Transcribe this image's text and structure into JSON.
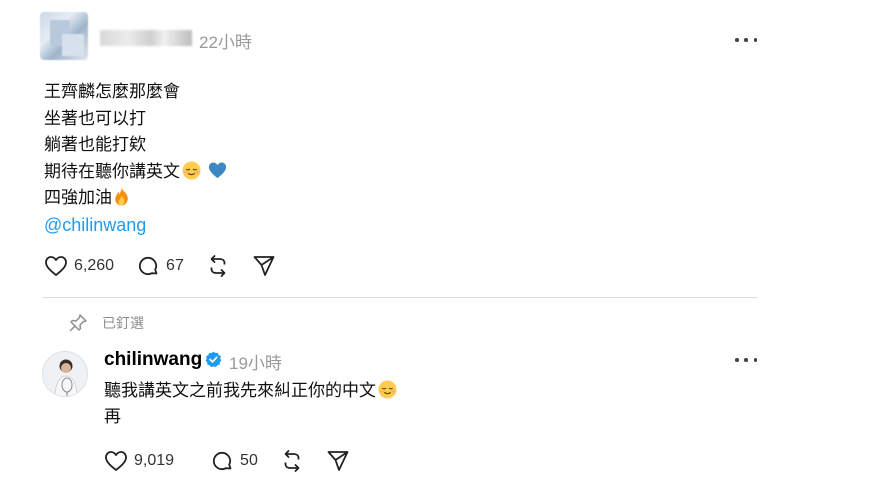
{
  "post": {
    "author_name": "",
    "timestamp": "22小時",
    "lines": [
      "王齊麟怎麼那麼會",
      "坐著也可以打",
      "躺著也能打欸",
      "期待在聽你講英文",
      "四強加油"
    ],
    "emojis": {
      "line4": [
        "relieved-face",
        "blue-heart"
      ],
      "line5": [
        "fire"
      ]
    },
    "mention": "@chilinwang",
    "likes": "6,260",
    "comments": "67"
  },
  "pinned": {
    "label": "已釘選"
  },
  "reply": {
    "author_name": "chilinwang",
    "timestamp": "19小時",
    "lines": [
      "聽我講英文之前我先來糾正你的中文",
      "再"
    ],
    "emojis": {
      "line1": [
        "relieved-face"
      ]
    },
    "likes": "9,019",
    "comments": "50"
  },
  "colors": {
    "link": "#1d9bf0",
    "verified": "#1d9bf0",
    "muted": "#999999"
  }
}
